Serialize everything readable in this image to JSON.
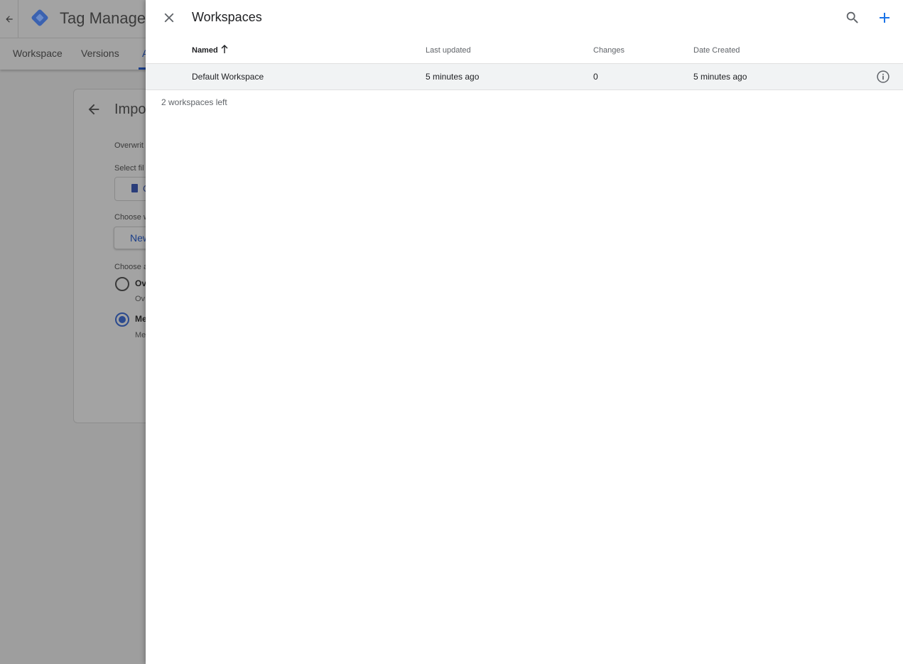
{
  "background": {
    "app_title": "Tag Manager",
    "tabs": [
      "Workspace",
      "Versions"
    ],
    "active_tab_fragment": "A",
    "card": {
      "title_fragment": "Impor",
      "overwrite_fragment": "Overwrit",
      "select_file_fragment": "Select fil",
      "file_button_fragment": "C",
      "choose_workspace_fragment": "Choose w",
      "new_button_fragment": "New",
      "choose_option_fragment": "Choose a",
      "option1_fragment": "Ov",
      "option1_sub_fragment": "Ov",
      "option2_fragment": "Me",
      "option2_sub_fragment": "Me"
    },
    "colors": {
      "accent": "#1a3e8a",
      "logo": "#3b62b0"
    }
  },
  "panel": {
    "title": "Workspaces",
    "columns": [
      {
        "key": "name",
        "label": "Named"
      },
      {
        "key": "last_updated",
        "label": "Last updated"
      },
      {
        "key": "changes",
        "label": "Changes"
      },
      {
        "key": "date_created",
        "label": "Date Created"
      }
    ],
    "sort": {
      "column": "Named",
      "direction": "ascending",
      "icon": "arrow-up-icon"
    },
    "rows": [
      {
        "name": "Default Workspace",
        "last_updated": "5 minutes ago",
        "changes": "0",
        "date_created": "5 minutes ago"
      }
    ],
    "footer": "2 workspaces left",
    "icons": {
      "close": "close-icon",
      "search": "search-icon",
      "add": "plus-icon",
      "row_action": "info-icon"
    },
    "colors": {
      "add_icon": "#1a73e8",
      "row_bg": "#f1f3f4"
    }
  }
}
